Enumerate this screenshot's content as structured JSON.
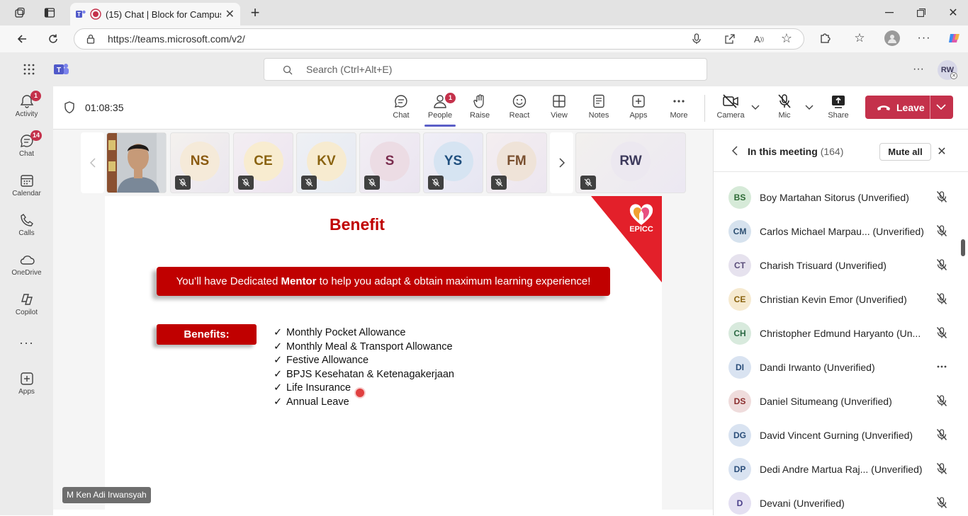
{
  "browser": {
    "tab_title": "(15) Chat | Block for Campus",
    "url": "https://teams.microsoft.com/v2/"
  },
  "teams": {
    "search_placeholder": "Search (Ctrl+Alt+E)",
    "user_initials": "RW"
  },
  "rail": [
    {
      "label": "Activity",
      "badge": "1",
      "icon": "bell-icon"
    },
    {
      "label": "Chat",
      "badge": "14",
      "icon": "chat-icon"
    },
    {
      "label": "Calendar",
      "badge": "",
      "icon": "calendar-icon"
    },
    {
      "label": "Calls",
      "badge": "",
      "icon": "phone-icon"
    },
    {
      "label": "OneDrive",
      "badge": "",
      "icon": "cloud-icon"
    },
    {
      "label": "Copilot",
      "badge": "",
      "icon": "copilot-icon"
    },
    {
      "label": "",
      "badge": "",
      "icon": "more-icon"
    },
    {
      "label": "Apps",
      "badge": "",
      "icon": "apps-icon"
    }
  ],
  "meeting": {
    "timer": "01:08:35",
    "buttons": {
      "chat": "Chat",
      "people": "People",
      "people_badge": "1",
      "raise": "Raise",
      "react": "React",
      "view": "View",
      "notes": "Notes",
      "apps": "Apps",
      "more": "More",
      "camera": "Camera",
      "mic": "Mic",
      "share": "Share",
      "leave": "Leave"
    }
  },
  "participants_strip": [
    {
      "initials": "NS",
      "bg": "#f5ead9",
      "fg": "#8a5a10"
    },
    {
      "initials": "CE",
      "bg": "#f8ecd0",
      "fg": "#8a6310"
    },
    {
      "initials": "KV",
      "bg": "#f7ebd0",
      "fg": "#8a6310"
    },
    {
      "initials": "S",
      "bg": "#ecdce4",
      "fg": "#7a2d4e"
    },
    {
      "initials": "YS",
      "bg": "#d6e4f2",
      "fg": "#1f4f7e"
    },
    {
      "initials": "FM",
      "bg": "#efe3d8",
      "fg": "#7a5030"
    },
    {
      "initials": "RW",
      "bg": "#ece8f0",
      "fg": "#3d3a5c"
    }
  ],
  "speaker_name": "M Ken Adi Irwansyah",
  "slide": {
    "title": "Benefit",
    "logo_text": "EPICC",
    "banner_pre": "You’ll have Dedicated ",
    "banner_bold": "Mentor",
    "banner_post": " to help you adapt & obtain maximum learning experience!",
    "benefits_label": "Benefits:",
    "items": [
      "Monthly Pocket Allowance",
      "Monthly Meal & Transport Allowance",
      "Festive Allowance",
      "BPJS Kesehatan & Ketenagakerjaan",
      "Life Insurance",
      "Annual Leave"
    ],
    "accent": "#c00000"
  },
  "roster": {
    "title": "In this meeting",
    "count": "(164)",
    "mute_all": "Mute all",
    "people": [
      {
        "initials": "BS",
        "name": "Boy Martahan Sitorus (Unverified)",
        "bg": "#d6ead8",
        "fg": "#2d6a35",
        "action": "mic-off"
      },
      {
        "initials": "CM",
        "name": "Carlos Michael Marpau... (Unverified)",
        "bg": "#d6e2ee",
        "fg": "#2c4f72",
        "action": "mic-off"
      },
      {
        "initials": "CT",
        "name": "Charish Trisuard (Unverified)",
        "bg": "#e6e2ee",
        "fg": "#5a4d7a",
        "action": "mic-off"
      },
      {
        "initials": "CE",
        "name": "Christian Kevin Emor (Unverified)",
        "bg": "#f6ead0",
        "fg": "#8a6310",
        "action": "mic-off"
      },
      {
        "initials": "CH",
        "name": "Christopher Edmund Haryanto (Un...",
        "bg": "#d8eadd",
        "fg": "#2d6a45",
        "action": "mic-off"
      },
      {
        "initials": "DI",
        "name": "Dandi Irwanto (Unverified)",
        "bg": "#d9e3f1",
        "fg": "#2b4e7a",
        "action": "more"
      },
      {
        "initials": "DS",
        "name": "Daniel Situmeang (Unverified)",
        "bg": "#efdcdc",
        "fg": "#8a2d2d",
        "action": "mic-off"
      },
      {
        "initials": "DG",
        "name": "David Vincent Gurning (Unverified)",
        "bg": "#d9e3f1",
        "fg": "#2b4e7a",
        "action": "mic-off"
      },
      {
        "initials": "DP",
        "name": "Dedi Andre Martua Raj... (Unverified)",
        "bg": "#d9e3f1",
        "fg": "#2b4e7a",
        "action": "mic-off"
      },
      {
        "initials": "D",
        "name": "Devani (Unverified)",
        "bg": "#e4e0f2",
        "fg": "#4a3f8a",
        "action": "mic-off"
      }
    ]
  }
}
